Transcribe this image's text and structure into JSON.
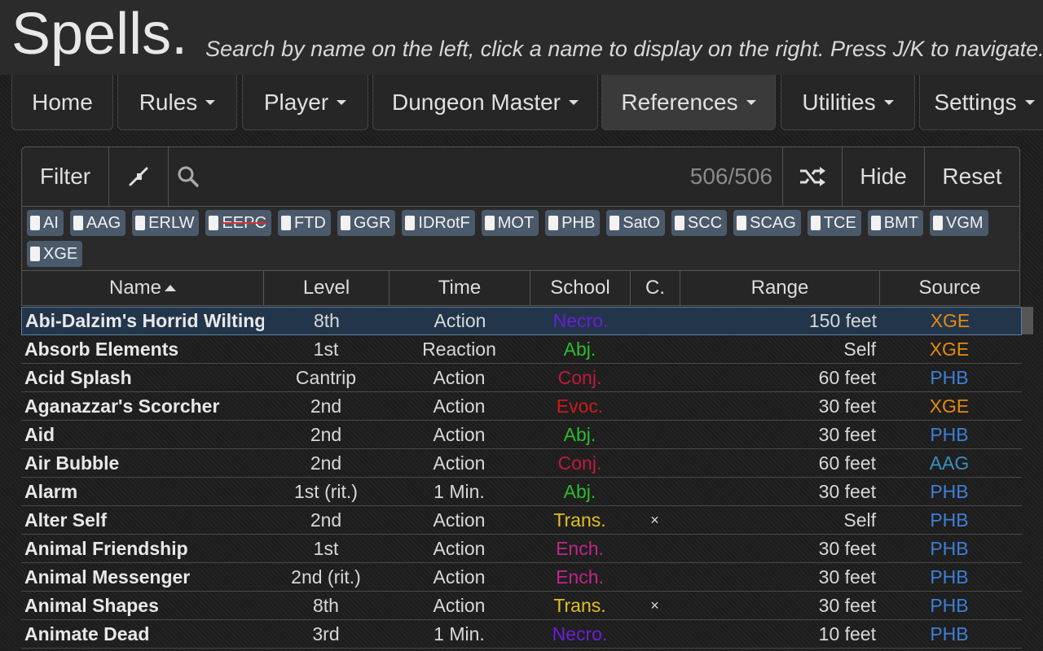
{
  "header": {
    "title": "Spells.",
    "subtitle": "Search by name on the left, click a name to display on the right. Press J/K to navigate."
  },
  "nav": {
    "items": [
      {
        "label": "Home",
        "dropdown": false
      },
      {
        "label": "Rules",
        "dropdown": true
      },
      {
        "label": "Player",
        "dropdown": true
      },
      {
        "label": "Dungeon Master",
        "dropdown": true
      },
      {
        "label": "References",
        "dropdown": true,
        "active": true
      },
      {
        "label": "Utilities",
        "dropdown": true
      },
      {
        "label": "Settings",
        "dropdown": true
      }
    ]
  },
  "filter_bar": {
    "filter_label": "Filter",
    "collapse_icon": "collapse-arrows-icon",
    "search_icon": "search-icon",
    "search_value": "",
    "count": "506/506",
    "shuffle_icon": "shuffle-icon",
    "hide_label": "Hide",
    "reset_label": "Reset"
  },
  "source_tags": [
    {
      "label": "AI",
      "struck": false
    },
    {
      "label": "AAG",
      "struck": false
    },
    {
      "label": "ERLW",
      "struck": false
    },
    {
      "label": "EEPC",
      "struck": true
    },
    {
      "label": "FTD",
      "struck": false
    },
    {
      "label": "GGR",
      "struck": false
    },
    {
      "label": "IDRotF",
      "struck": false
    },
    {
      "label": "MOT",
      "struck": false
    },
    {
      "label": "PHB",
      "struck": false
    },
    {
      "label": "SatO",
      "struck": false
    },
    {
      "label": "SCC",
      "struck": false
    },
    {
      "label": "SCAG",
      "struck": false
    },
    {
      "label": "TCE",
      "struck": false
    },
    {
      "label": "BMT",
      "struck": false
    },
    {
      "label": "VGM",
      "struck": false
    },
    {
      "label": "XGE",
      "struck": false
    }
  ],
  "table": {
    "columns": {
      "name": "Name",
      "level": "Level",
      "time": "Time",
      "school": "School",
      "concentration": "C.",
      "range": "Range",
      "source": "Source"
    },
    "colors": {
      "Necro.": "#6a1fd8",
      "Abj.": "#2dbb2d",
      "Conj.": "#c01a3a",
      "Evoc.": "#d01a1a",
      "Trans.": "#e0c020",
      "Ench.": "#c0268a",
      "XGE": "#e38a10",
      "PHB": "#3d7fd6",
      "AAG": "#3a8fc0"
    },
    "rows": [
      {
        "name": "Abi-Dalzim's Horrid Wilting",
        "level": "8th",
        "time": "Action",
        "school": "Necro.",
        "conc": "",
        "range": "150 feet",
        "source": "XGE",
        "selected": true
      },
      {
        "name": "Absorb Elements",
        "level": "1st",
        "time": "Reaction",
        "school": "Abj.",
        "conc": "",
        "range": "Self",
        "source": "XGE"
      },
      {
        "name": "Acid Splash",
        "level": "Cantrip",
        "time": "Action",
        "school": "Conj.",
        "conc": "",
        "range": "60 feet",
        "source": "PHB"
      },
      {
        "name": "Aganazzar's Scorcher",
        "level": "2nd",
        "time": "Action",
        "school": "Evoc.",
        "conc": "",
        "range": "30 feet",
        "source": "XGE"
      },
      {
        "name": "Aid",
        "level": "2nd",
        "time": "Action",
        "school": "Abj.",
        "conc": "",
        "range": "30 feet",
        "source": "PHB"
      },
      {
        "name": "Air Bubble",
        "level": "2nd",
        "time": "Action",
        "school": "Conj.",
        "conc": "",
        "range": "60 feet",
        "source": "AAG"
      },
      {
        "name": "Alarm",
        "level": "1st (rit.)",
        "time": "1 Min.",
        "school": "Abj.",
        "conc": "",
        "range": "30 feet",
        "source": "PHB"
      },
      {
        "name": "Alter Self",
        "level": "2nd",
        "time": "Action",
        "school": "Trans.",
        "conc": "×",
        "range": "Self",
        "source": "PHB"
      },
      {
        "name": "Animal Friendship",
        "level": "1st",
        "time": "Action",
        "school": "Ench.",
        "conc": "",
        "range": "30 feet",
        "source": "PHB"
      },
      {
        "name": "Animal Messenger",
        "level": "2nd (rit.)",
        "time": "Action",
        "school": "Ench.",
        "conc": "",
        "range": "30 feet",
        "source": "PHB"
      },
      {
        "name": "Animal Shapes",
        "level": "8th",
        "time": "Action",
        "school": "Trans.",
        "conc": "×",
        "range": "30 feet",
        "source": "PHB"
      },
      {
        "name": "Animate Dead",
        "level": "3rd",
        "time": "1 Min.",
        "school": "Necro.",
        "conc": "",
        "range": "10 feet",
        "source": "PHB"
      }
    ]
  }
}
